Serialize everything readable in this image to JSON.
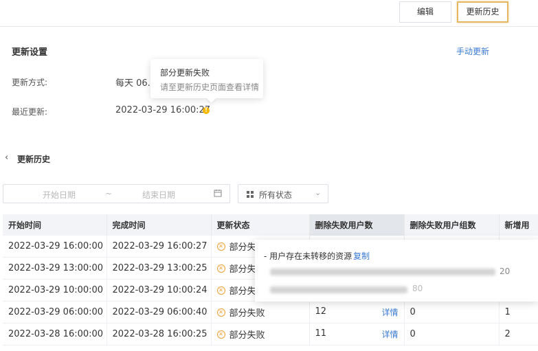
{
  "toolbar": {
    "edit_label": "编辑",
    "history_label": "更新历史"
  },
  "settings": {
    "title": "更新设置",
    "manual_update": "手动更新",
    "method_label": "更新方式:",
    "method_value": "每天 06.1",
    "last_label": "最近更新:",
    "last_value": "2022-03-29 16:00:27"
  },
  "popover": {
    "title": "部分更新失败",
    "text": "请至更新历史页面查看详情"
  },
  "history": {
    "title": "更新历史",
    "start_placeholder": "开始日期",
    "separator": "~",
    "end_placeholder": "结束日期",
    "status_filter": "所有状态"
  },
  "table": {
    "columns": [
      "开始时间",
      "完成时间",
      "更新状态",
      "删除失败用户数",
      "删除失败用户组数",
      "新增用"
    ],
    "detail_label": "详情",
    "rows": [
      {
        "start": "2022-03-29 16:00:00",
        "end": "2022-03-29 16:00:27",
        "status": "部分失败"
      },
      {
        "start": "2022-03-29 13:00:00",
        "end": "2022-03-29 13:00:25",
        "status": "部分失败"
      },
      {
        "start": "2022-03-29 10:00:00",
        "end": "2022-03-29 10:00:24",
        "status": "部分失败"
      },
      {
        "start": "2022-03-29 06:00:00",
        "end": "2022-03-29 06:00:40",
        "status": "部分失败",
        "del_users": "12",
        "del_groups": "0",
        "new": "1"
      },
      {
        "start": "2022-03-28 16:00:00",
        "end": "2022-03-28 16:00:25",
        "status": "部分失败",
        "del_users": "11",
        "del_groups": "0",
        "new": "2"
      }
    ]
  },
  "tooltip": {
    "heading": "- 用户存在未转移的资源",
    "copy": "复制",
    "tail_1": "20",
    "tail_2": "80"
  }
}
